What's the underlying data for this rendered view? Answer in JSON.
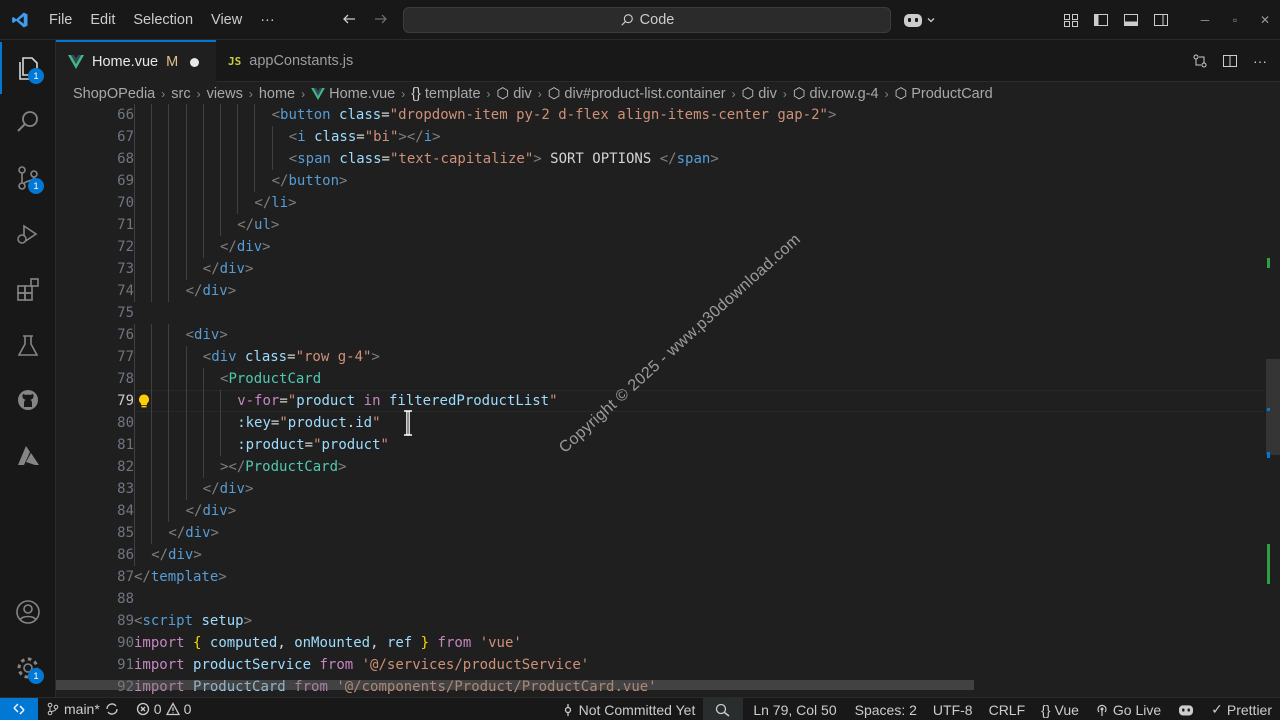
{
  "titlebar": {
    "menu": [
      "File",
      "Edit",
      "Selection",
      "View",
      "···"
    ],
    "search_text": "Code"
  },
  "activitybar": {
    "explorer_badge": "1",
    "scm_badge": "1",
    "settings_badge": "1"
  },
  "tabs": [
    {
      "label": "Home.vue",
      "status": "M",
      "icon": "vue-icon",
      "active": true,
      "modified_dot": true
    },
    {
      "label": "appConstants.js",
      "icon": "js-icon",
      "active": false
    }
  ],
  "breadcrumb": [
    "ShopOPedia",
    "src",
    "views",
    "home",
    "Home.vue",
    "template",
    "div",
    "div#product-list.container",
    "div",
    "div.row.g-4",
    "ProductCard"
  ],
  "editor": {
    "current_line": 79,
    "lines": [
      {
        "n": "66",
        "indent": 16,
        "html": "<span class='t-tag'>&lt;</span><span class='t-name'>button</span> <span class='t-attr'>class</span><span class='t-text'>=</span><span class='t-str'>\"dropdown-item py-2 d-flex align-items-center gap-2\"</span><span class='t-tag'>&gt;</span>"
      },
      {
        "n": "67",
        "indent": 18,
        "html": "<span class='t-tag'>&lt;</span><span class='t-name'>i</span> <span class='t-attr'>class</span><span class='t-text'>=</span><span class='t-str'>\"bi\"</span><span class='t-tag'>&gt;&lt;/</span><span class='t-name'>i</span><span class='t-tag'>&gt;</span>"
      },
      {
        "n": "68",
        "indent": 18,
        "html": "<span class='t-tag'>&lt;</span><span class='t-name'>span</span> <span class='t-attr'>class</span><span class='t-text'>=</span><span class='t-str'>\"text-capitalize\"</span><span class='t-tag'>&gt;</span><span class='t-text'> SORT OPTIONS </span><span class='t-tag'>&lt;/</span><span class='t-name'>span</span><span class='t-tag'>&gt;</span>"
      },
      {
        "n": "69",
        "indent": 16,
        "html": "<span class='t-tag'>&lt;/</span><span class='t-name'>button</span><span class='t-tag'>&gt;</span>"
      },
      {
        "n": "70",
        "indent": 14,
        "html": "<span class='t-tag'>&lt;/</span><span class='t-name'>li</span><span class='t-tag'>&gt;</span>"
      },
      {
        "n": "71",
        "indent": 12,
        "html": "<span class='t-tag'>&lt;/</span><span class='t-name'>ul</span><span class='t-tag'>&gt;</span>"
      },
      {
        "n": "72",
        "indent": 10,
        "html": "<span class='t-tag'>&lt;/</span><span class='t-name'>div</span><span class='t-tag'>&gt;</span>"
      },
      {
        "n": "73",
        "indent": 8,
        "html": "<span class='t-tag'>&lt;/</span><span class='t-name'>div</span><span class='t-tag'>&gt;</span>"
      },
      {
        "n": "74",
        "indent": 6,
        "html": "<span class='t-tag'>&lt;/</span><span class='t-name'>div</span><span class='t-tag'>&gt;</span>"
      },
      {
        "n": "75",
        "indent": 0,
        "html": ""
      },
      {
        "n": "76",
        "indent": 6,
        "html": "<span class='t-tag'>&lt;</span><span class='t-name'>div</span><span class='t-tag'>&gt;</span>"
      },
      {
        "n": "77",
        "indent": 8,
        "html": "<span class='t-tag'>&lt;</span><span class='t-name'>div</span> <span class='t-attr'>class</span><span class='t-text'>=</span><span class='t-str'>\"row g-4\"</span><span class='t-tag'>&gt;</span>"
      },
      {
        "n": "78",
        "indent": 10,
        "html": "<span class='t-tag'>&lt;</span><span class='t-comp'>ProductCard</span>"
      },
      {
        "n": "79",
        "indent": 12,
        "html": "<span class='t-kw'>v-for</span><span class='t-text'>=</span><span class='t-str'>\"</span><span class='t-var'>product</span> <span class='t-kw'>in</span> <span class='t-var'>filteredProductList</span><span class='t-str'>\"</span>"
      },
      {
        "n": "80",
        "indent": 12,
        "html": "<span class='t-attr'>:key</span><span class='t-text'>=</span><span class='t-str'>\"</span><span class='t-var'>product</span><span class='t-text'>.</span><span class='t-var'>id</span><span class='t-str'>\"</span>"
      },
      {
        "n": "81",
        "indent": 12,
        "html": "<span class='t-attr'>:product</span><span class='t-text'>=</span><span class='t-str'>\"</span><span class='t-var'>product</span><span class='t-str'>\"</span>"
      },
      {
        "n": "82",
        "indent": 10,
        "html": "<span class='t-tag'>&gt;&lt;/</span><span class='t-comp'>ProductCard</span><span class='t-tag'>&gt;</span>"
      },
      {
        "n": "83",
        "indent": 8,
        "html": "<span class='t-tag'>&lt;/</span><span class='t-name'>div</span><span class='t-tag'>&gt;</span>"
      },
      {
        "n": "84",
        "indent": 6,
        "html": "<span class='t-tag'>&lt;/</span><span class='t-name'>div</span><span class='t-tag'>&gt;</span>"
      },
      {
        "n": "85",
        "indent": 4,
        "html": "<span class='t-tag'>&lt;/</span><span class='t-name'>div</span><span class='t-tag'>&gt;</span>"
      },
      {
        "n": "86",
        "indent": 2,
        "html": "<span class='t-tag'>&lt;/</span><span class='t-name'>div</span><span class='t-tag'>&gt;</span>"
      },
      {
        "n": "87",
        "indent": 0,
        "html": "<span class='t-tag'>&lt;/</span><span class='t-name'>template</span><span class='t-tag'>&gt;</span>"
      },
      {
        "n": "88",
        "indent": 0,
        "html": ""
      },
      {
        "n": "89",
        "indent": 0,
        "html": "<span class='t-tag'>&lt;</span><span class='t-name'>script</span> <span class='t-attr'>setup</span><span class='t-tag'>&gt;</span>"
      },
      {
        "n": "90",
        "indent": 0,
        "html": "<span class='t-kw'>import</span> <span class='t-brace'>{</span> <span class='t-var'>computed</span><span class='t-text'>,</span> <span class='t-var'>onMounted</span><span class='t-text'>,</span> <span class='t-var'>ref</span> <span class='t-brace'>}</span> <span class='t-kw'>from</span> <span class='t-str'>'vue'</span>"
      },
      {
        "n": "91",
        "indent": 0,
        "html": "<span class='t-kw'>import</span> <span class='t-var'>productService</span> <span class='t-kw'>from</span> <span class='t-str'>'@/services/productService'</span>"
      },
      {
        "n": "92",
        "indent": 0,
        "html": "<span class='t-kw'>import</span> <span class='t-var'>ProductCard</span> <span class='t-kw'>from</span> <span class='t-str'>'@/components/Product/ProductCard.vue'</span>"
      }
    ]
  },
  "watermark": "Copyright © 2025 - www.p30download.com",
  "statusbar": {
    "branch": "main*",
    "errors": "0",
    "warnings": "0",
    "commit": "Not Committed Yet",
    "position": "Ln 79, Col 50",
    "spaces": "Spaces: 2",
    "encoding": "UTF-8",
    "eol": "CRLF",
    "language": "Vue",
    "golive": "Go Live",
    "prettier": "Prettier"
  },
  "colors": {
    "accent": "#0078d4",
    "modified": "#e2c08d",
    "vue_green": "#41b883"
  }
}
